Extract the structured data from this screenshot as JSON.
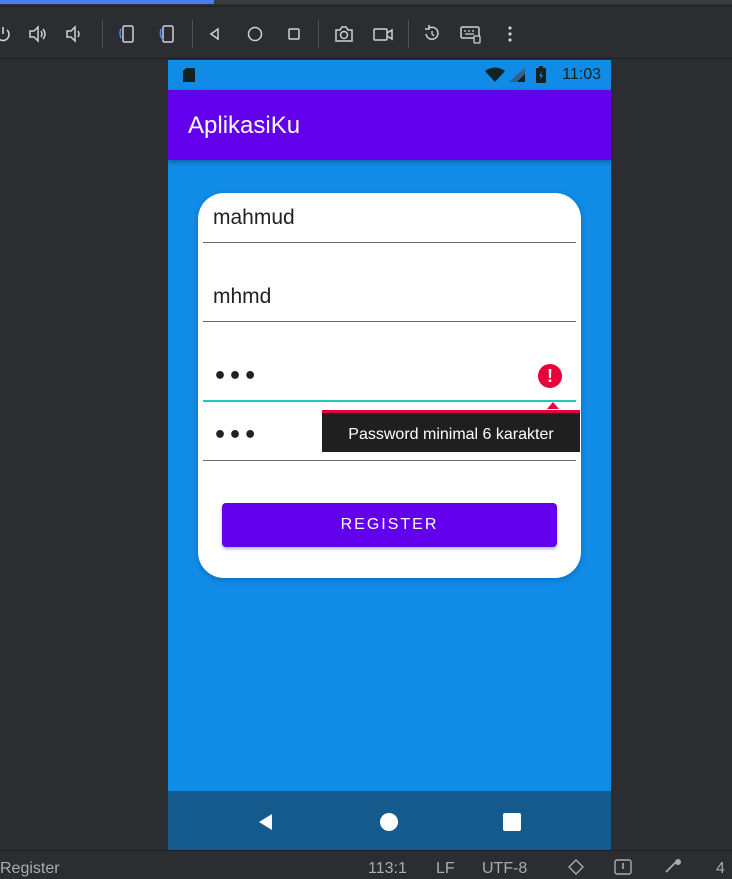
{
  "ide": {
    "toolbar_icons": [
      "power-icon",
      "volume-up-icon",
      "volume-down-icon",
      "rotate-left-icon",
      "rotate-right-icon",
      "back-icon",
      "home-icon",
      "overview-icon",
      "screenshot-icon",
      "screen-record-icon",
      "reset-icon",
      "keyboard-icon",
      "more-icon"
    ],
    "status": {
      "left": "Register",
      "position": "113:1",
      "line_ending": "LF",
      "encoding": "UTF-8",
      "indent": "4"
    }
  },
  "phone": {
    "status_time": "11:03",
    "app_title": "AplikasiKu",
    "form": {
      "name_value": "mahmud",
      "username_value": "mhmd",
      "password_dots": "•••",
      "confirm_dots": "•••",
      "error_tooltip": "Password minimal 6 karakter",
      "register_label": "REGISTER"
    }
  },
  "colors": {
    "accent": "#6200ee",
    "screen_bg": "#108be6",
    "error": "#e8003b",
    "focus_line": "#1dc9b7"
  }
}
